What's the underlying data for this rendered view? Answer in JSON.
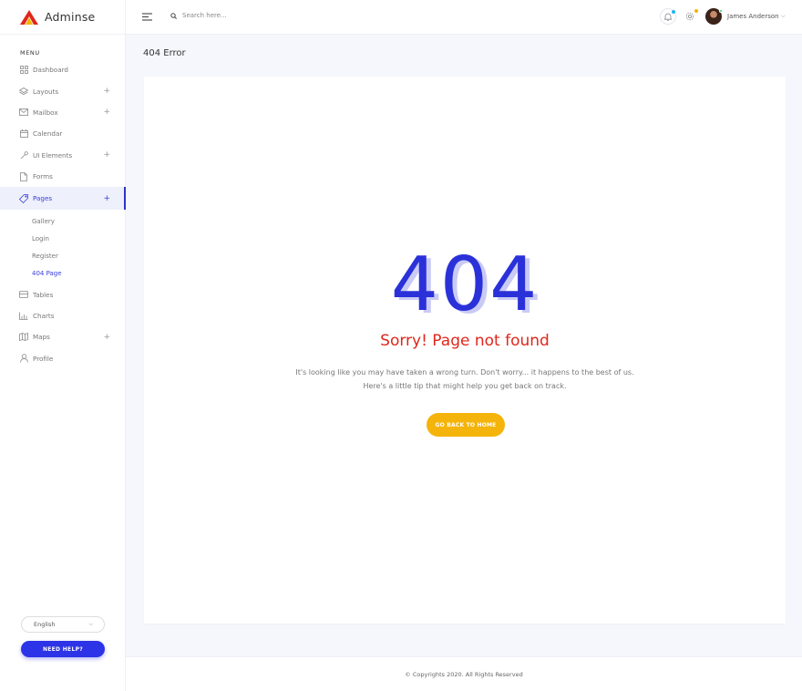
{
  "brand": {
    "name": "Adminse"
  },
  "sidebar": {
    "menu_heading": "MENU",
    "items": [
      {
        "label": "Dashboard",
        "icon": "grid-icon",
        "expandable": false
      },
      {
        "label": "Layouts",
        "icon": "layers-icon",
        "expandable": true
      },
      {
        "label": "Mailbox",
        "icon": "mail-icon",
        "expandable": true
      },
      {
        "label": "Calendar",
        "icon": "calendar-icon",
        "expandable": false
      },
      {
        "label": "UI Elements",
        "icon": "tools-icon",
        "expandable": true
      },
      {
        "label": "Forms",
        "icon": "file-icon",
        "expandable": false
      },
      {
        "label": "Pages",
        "icon": "tag-icon",
        "expandable": true,
        "active": true
      },
      {
        "label": "Tables",
        "icon": "table-icon",
        "expandable": false
      },
      {
        "label": "Charts",
        "icon": "bar-chart-icon",
        "expandable": false
      },
      {
        "label": "Maps",
        "icon": "map-icon",
        "expandable": true
      },
      {
        "label": "Profile",
        "icon": "user-icon",
        "expandable": false
      }
    ],
    "expand_symbol": "+",
    "pages_subitems": [
      "Gallery",
      "Login",
      "Register",
      "404 Page"
    ],
    "language": "English",
    "help_label": "NEED HELP?"
  },
  "topbar": {
    "search_placeholder": "Search here...",
    "user_name": "James Anderson",
    "notification_dot_color": "#1fb5f0",
    "settings_dot_color": "#f4b40b"
  },
  "page": {
    "title": "404 Error"
  },
  "error": {
    "code": "404",
    "headline": "Sorry! Page not found",
    "line1": "It's looking like you may have taken a wrong turn. Don't worry... it happens to the best of us.",
    "line2": "Here's a little tip that might help you get back on track.",
    "button_label": "GO BACK TO HOME"
  },
  "footer": {
    "text": "© Copyrights 2020. All Rights Reserved"
  },
  "colors": {
    "accent": "#2d33e6",
    "error_red": "#e0261b",
    "button_yellow": "#f4b40b"
  }
}
